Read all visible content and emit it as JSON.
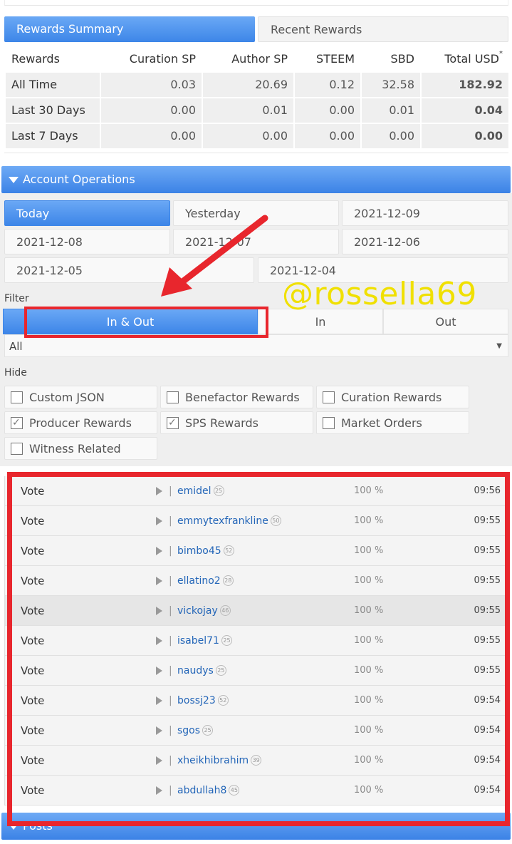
{
  "rewards_summary": {
    "tabs": [
      {
        "label": "Rewards Summary",
        "active": true
      },
      {
        "label": "Recent Rewards",
        "active": false
      }
    ],
    "headers": [
      "Rewards",
      "Curation SP",
      "Author SP",
      "STEEM",
      "SBD",
      "Total USD"
    ],
    "total_usd_marker": "*",
    "rows": [
      {
        "period": "All Time",
        "curation_sp": "0.03",
        "author_sp": "20.69",
        "steem": "0.12",
        "sbd": "32.58",
        "total_usd": "182.92"
      },
      {
        "period": "Last 30 Days",
        "curation_sp": "0.00",
        "author_sp": "0.01",
        "steem": "0.00",
        "sbd": "0.01",
        "total_usd": "0.04"
      },
      {
        "period": "Last 7 Days",
        "curation_sp": "0.00",
        "author_sp": "0.00",
        "steem": "0.00",
        "sbd": "0.00",
        "total_usd": "0.00"
      }
    ]
  },
  "account_operations": {
    "title": "Account Operations",
    "days": [
      "Today",
      "Yesterday",
      "2021-12-09",
      "2021-12-08",
      "2021-12-07",
      "2021-12-06",
      "2021-12-05",
      "2021-12-04"
    ],
    "active_day": "Today",
    "filter_label": "Filter",
    "filter_options": [
      "In & Out",
      "In",
      "Out"
    ],
    "active_filter": "In & Out",
    "select_value": "All",
    "hide_label": "Hide",
    "hide_options": [
      {
        "label": "Custom JSON",
        "checked": false
      },
      {
        "label": "Benefactor Rewards",
        "checked": false
      },
      {
        "label": "Curation Rewards",
        "checked": false
      },
      {
        "label": "Producer Rewards",
        "checked": true
      },
      {
        "label": "SPS Rewards",
        "checked": true
      },
      {
        "label": "Market Orders",
        "checked": false
      },
      {
        "label": "Witness Related",
        "checked": false
      }
    ]
  },
  "watermark": "@rossella69",
  "votes": [
    {
      "type": "Vote",
      "user": "emidel",
      "rep": "25",
      "percent": "100 %",
      "time": "09:56"
    },
    {
      "type": "Vote",
      "user": "emmytexfrankline",
      "rep": "50",
      "percent": "100 %",
      "time": "09:55"
    },
    {
      "type": "Vote",
      "user": "bimbo45",
      "rep": "52",
      "percent": "100 %",
      "time": "09:55"
    },
    {
      "type": "Vote",
      "user": "ellatino2",
      "rep": "28",
      "percent": "100 %",
      "time": "09:55"
    },
    {
      "type": "Vote",
      "user": "vickojay",
      "rep": "46",
      "percent": "100 %",
      "time": "09:55"
    },
    {
      "type": "Vote",
      "user": "isabel71",
      "rep": "25",
      "percent": "100 %",
      "time": "09:55"
    },
    {
      "type": "Vote",
      "user": "naudys",
      "rep": "25",
      "percent": "100 %",
      "time": "09:55"
    },
    {
      "type": "Vote",
      "user": "bossj23",
      "rep": "52",
      "percent": "100 %",
      "time": "09:54"
    },
    {
      "type": "Vote",
      "user": "sgos",
      "rep": "25",
      "percent": "100 %",
      "time": "09:54"
    },
    {
      "type": "Vote",
      "user": "xheikhibrahim",
      "rep": "39",
      "percent": "100 %",
      "time": "09:54"
    },
    {
      "type": "Vote",
      "user": "abdullah8",
      "rep": "45",
      "percent": "100 %",
      "time": "09:54"
    }
  ],
  "posts_header": "Posts",
  "annotation_color": "#e8262d",
  "accent_color": "#3d86e8",
  "watermark_color": "#f0e000"
}
